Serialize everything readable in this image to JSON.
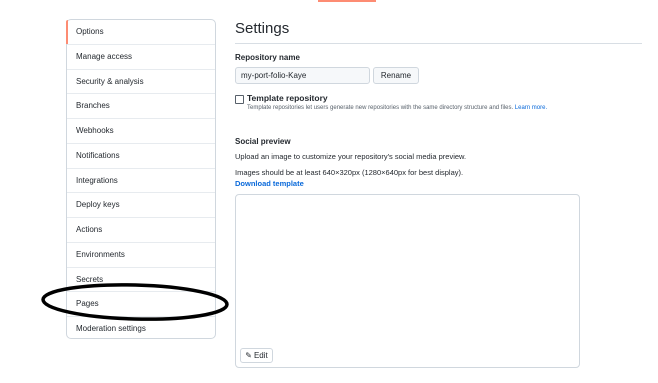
{
  "sidebar": {
    "items": [
      {
        "label": "Options",
        "selected": true
      },
      {
        "label": "Manage access"
      },
      {
        "label": "Security & analysis"
      },
      {
        "label": "Branches"
      },
      {
        "label": "Webhooks"
      },
      {
        "label": "Notifications"
      },
      {
        "label": "Integrations"
      },
      {
        "label": "Deploy keys"
      },
      {
        "label": "Actions"
      },
      {
        "label": "Environments"
      },
      {
        "label": "Secrets"
      },
      {
        "label": "Pages"
      },
      {
        "label": "Moderation settings"
      }
    ]
  },
  "main": {
    "title": "Settings",
    "repo_name_label": "Repository name",
    "repo_name_value": "my-port-folio-Kaye",
    "rename_label": "Rename",
    "template_label": "Template repository",
    "template_desc": "Template repositories let users generate new repositories with the same directory structure and files.",
    "learn_more": "Learn more.",
    "social_preview_label": "Social preview",
    "upload_text": "Upload an image to customize your repository's social media preview.",
    "size_text": "Images should be at least 640×320px (1280×640px for best display).",
    "download_template": "Download template",
    "edit_label": "Edit"
  },
  "colors": {
    "accent": "#fd8c73",
    "link": "#0969da",
    "annotation": "#000000"
  },
  "icons": {
    "edit": "pencil-icon"
  }
}
